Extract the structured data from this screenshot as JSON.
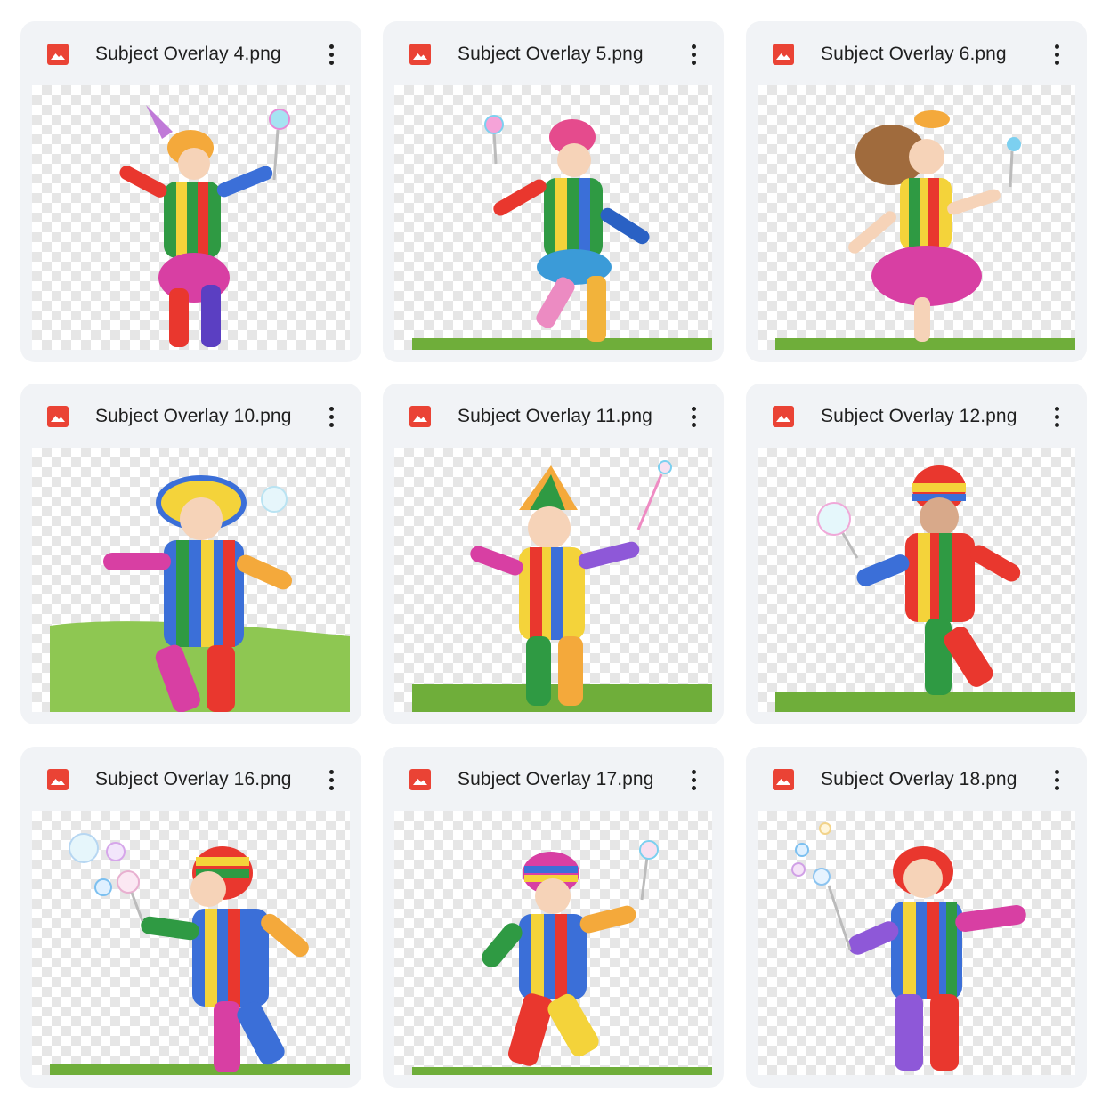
{
  "files": [
    {
      "name": "Subject Overlay 4.png",
      "icon": "image-file-icon"
    },
    {
      "name": "Subject Overlay 5.png",
      "icon": "image-file-icon"
    },
    {
      "name": "Subject Overlay 6.png",
      "icon": "image-file-icon"
    },
    {
      "name": "Subject Overlay 10.png",
      "icon": "image-file-icon"
    },
    {
      "name": "Subject Overlay 11.png",
      "icon": "image-file-icon"
    },
    {
      "name": "Subject Overlay 12.png",
      "icon": "image-file-icon"
    },
    {
      "name": "Subject Overlay 16.png",
      "icon": "image-file-icon"
    },
    {
      "name": "Subject Overlay 17.png",
      "icon": "image-file-icon"
    },
    {
      "name": "Subject Overlay 18.png",
      "icon": "image-file-icon"
    }
  ],
  "colors": {
    "card_bg": "#f1f3f6",
    "file_icon": "#ea4335",
    "text": "#1f1f1f",
    "grass": "#6fae3a",
    "checker": "#e6e6e6"
  }
}
